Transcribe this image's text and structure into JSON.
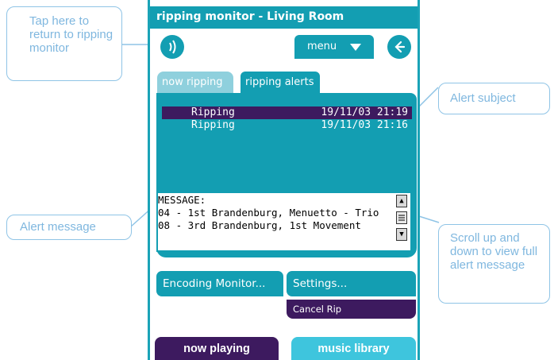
{
  "window": {
    "title": "ripping monitor - Living Room"
  },
  "toolbar": {
    "menu_label": "menu"
  },
  "tabs": [
    {
      "label": "now ripping"
    },
    {
      "label": "ripping alerts"
    }
  ],
  "alerts": [
    {
      "subject": "Ripping",
      "date": "19/11/03 21:19",
      "selected": true
    },
    {
      "subject": "Ripping",
      "date": "19/11/03 21:16",
      "selected": false
    }
  ],
  "message": {
    "lines": [
      "MESSAGE:",
      "04 - 1st Brandenburg, Menuetto - Trio",
      "08 - 3rd Brandenburg, 1st Movement"
    ]
  },
  "buttons": {
    "encoding_monitor": "Encoding Monitor...",
    "settings": "Settings...",
    "cancel_rip": "Cancel Rip"
  },
  "bottom_nav": {
    "now_playing": "now playing",
    "music_library": "music library"
  },
  "callouts": {
    "return": "Tap here to return to ripping monitor",
    "subject": "Alert subject",
    "message": "Alert message",
    "scroll": "Scroll up and down to view full alert message"
  },
  "colors": {
    "teal": "#139eb2",
    "purple": "#3d1a5f",
    "light_teal": "#3ec5dd",
    "callout_border": "#8fc4e6"
  },
  "icons": {
    "speaker": "speaker-icon",
    "back": "back-arrow-icon",
    "menu_arrow": "caret-down-icon"
  }
}
